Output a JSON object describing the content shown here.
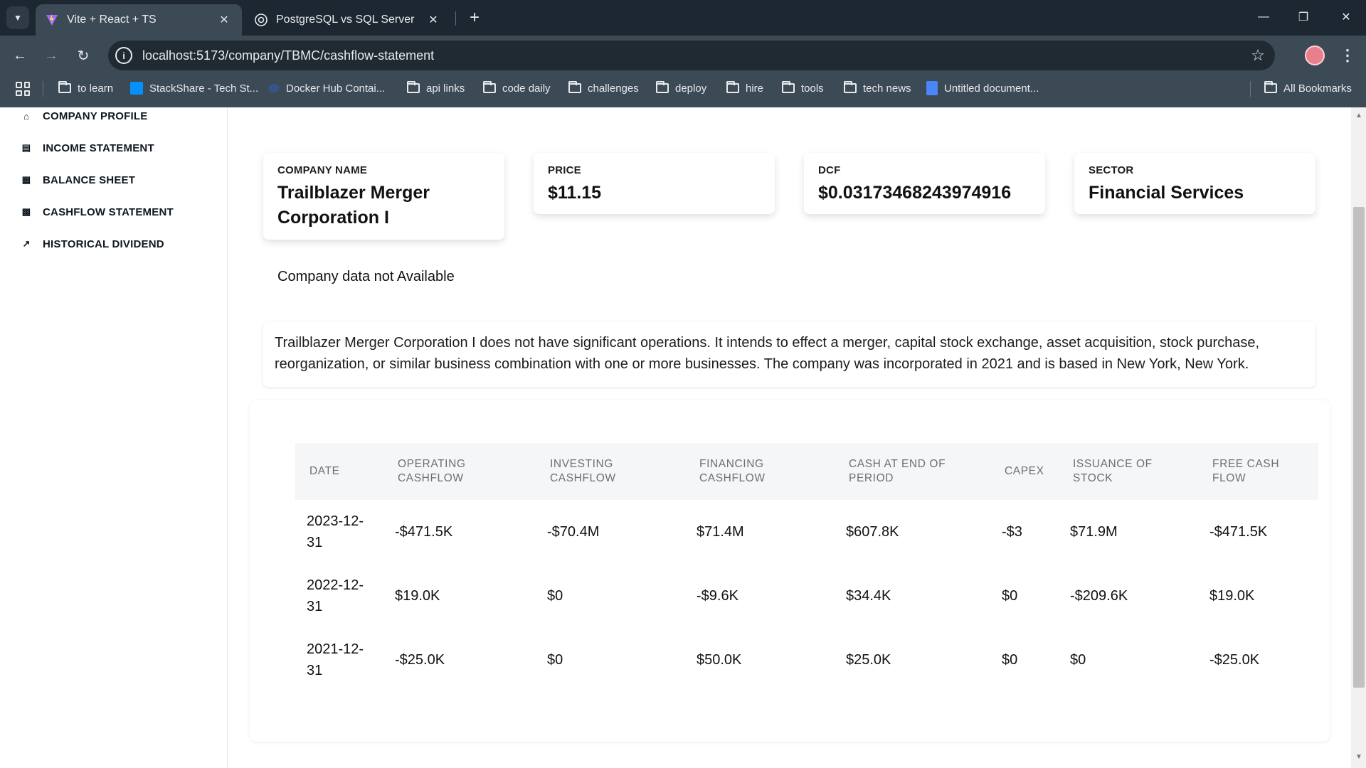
{
  "browser": {
    "tabs": [
      {
        "title": "Vite + React + TS",
        "active": true,
        "icon": "vite-icon"
      },
      {
        "title": "PostgreSQL vs SQL Server",
        "active": false,
        "icon": "openai-icon"
      }
    ],
    "url": "localhost:5173/company/TBMC/cashflow-statement",
    "bookmarks": [
      {
        "label": "to learn",
        "icon": "folder-icon"
      },
      {
        "label": "StackShare - Tech St...",
        "icon": "stackshare-icon"
      },
      {
        "label": "Docker Hub Contai...",
        "icon": "docker-icon"
      },
      {
        "label": "api links",
        "icon": "folder-icon"
      },
      {
        "label": "code daily",
        "icon": "folder-icon"
      },
      {
        "label": "challenges",
        "icon": "folder-icon"
      },
      {
        "label": "deploy",
        "icon": "folder-icon"
      },
      {
        "label": "hire",
        "icon": "folder-icon"
      },
      {
        "label": "tools",
        "icon": "folder-icon"
      },
      {
        "label": "tech news",
        "icon": "folder-icon"
      },
      {
        "label": "Untitled document...",
        "icon": "google-docs-icon"
      }
    ],
    "all_bookmarks": "All Bookmarks"
  },
  "sidebar": {
    "items": [
      {
        "label": "COMPANY PROFILE",
        "icon": "home-icon"
      },
      {
        "label": "INCOME STATEMENT",
        "icon": "table-icon"
      },
      {
        "label": "BALANCE SHEET",
        "icon": "grid-icon"
      },
      {
        "label": "CASHFLOW STATEMENT",
        "icon": "money-icon"
      },
      {
        "label": "HISTORICAL DIVIDEND",
        "icon": "trend-icon"
      }
    ]
  },
  "cards": {
    "company": {
      "label": "COMPANY NAME",
      "value": "Trailblazer Merger Corporation I"
    },
    "price": {
      "label": "PRICE",
      "value": "$11.15"
    },
    "dcf": {
      "label": "DCF",
      "value": "$0.03173468243974916"
    },
    "sector": {
      "label": "SECTOR",
      "value": "Financial Services"
    }
  },
  "notice": "Company data not Available",
  "description": "Trailblazer Merger Corporation I does not have significant operations. It intends to effect a merger, capital stock exchange, asset acquisition, stock purchase, reorganization, or similar business combination with one or more businesses. The company was incorporated in 2021 and is based in New York, New York.",
  "table": {
    "headers": [
      "DATE",
      "OPERATING CASHFLOW",
      "INVESTING CASHFLOW",
      "FINANCING CASHFLOW",
      "CASH AT END OF PERIOD",
      "CAPEX",
      "ISSUANCE OF STOCK",
      "FREE CASH FLOW"
    ],
    "rows": [
      [
        "2023-12-31",
        "-$471.5K",
        "-$70.4M",
        "$71.4M",
        "$607.8K",
        "-$3",
        "$71.9M",
        "-$471.5K"
      ],
      [
        "2022-12-31",
        "$19.0K",
        "$0",
        "-$9.6K",
        "$34.4K",
        "$0",
        "-$209.6K",
        "$19.0K"
      ],
      [
        "2021-12-31",
        "-$25.0K",
        "$0",
        "$50.0K",
        "$25.0K",
        "$0",
        "$0",
        "-$25.0K"
      ]
    ]
  }
}
